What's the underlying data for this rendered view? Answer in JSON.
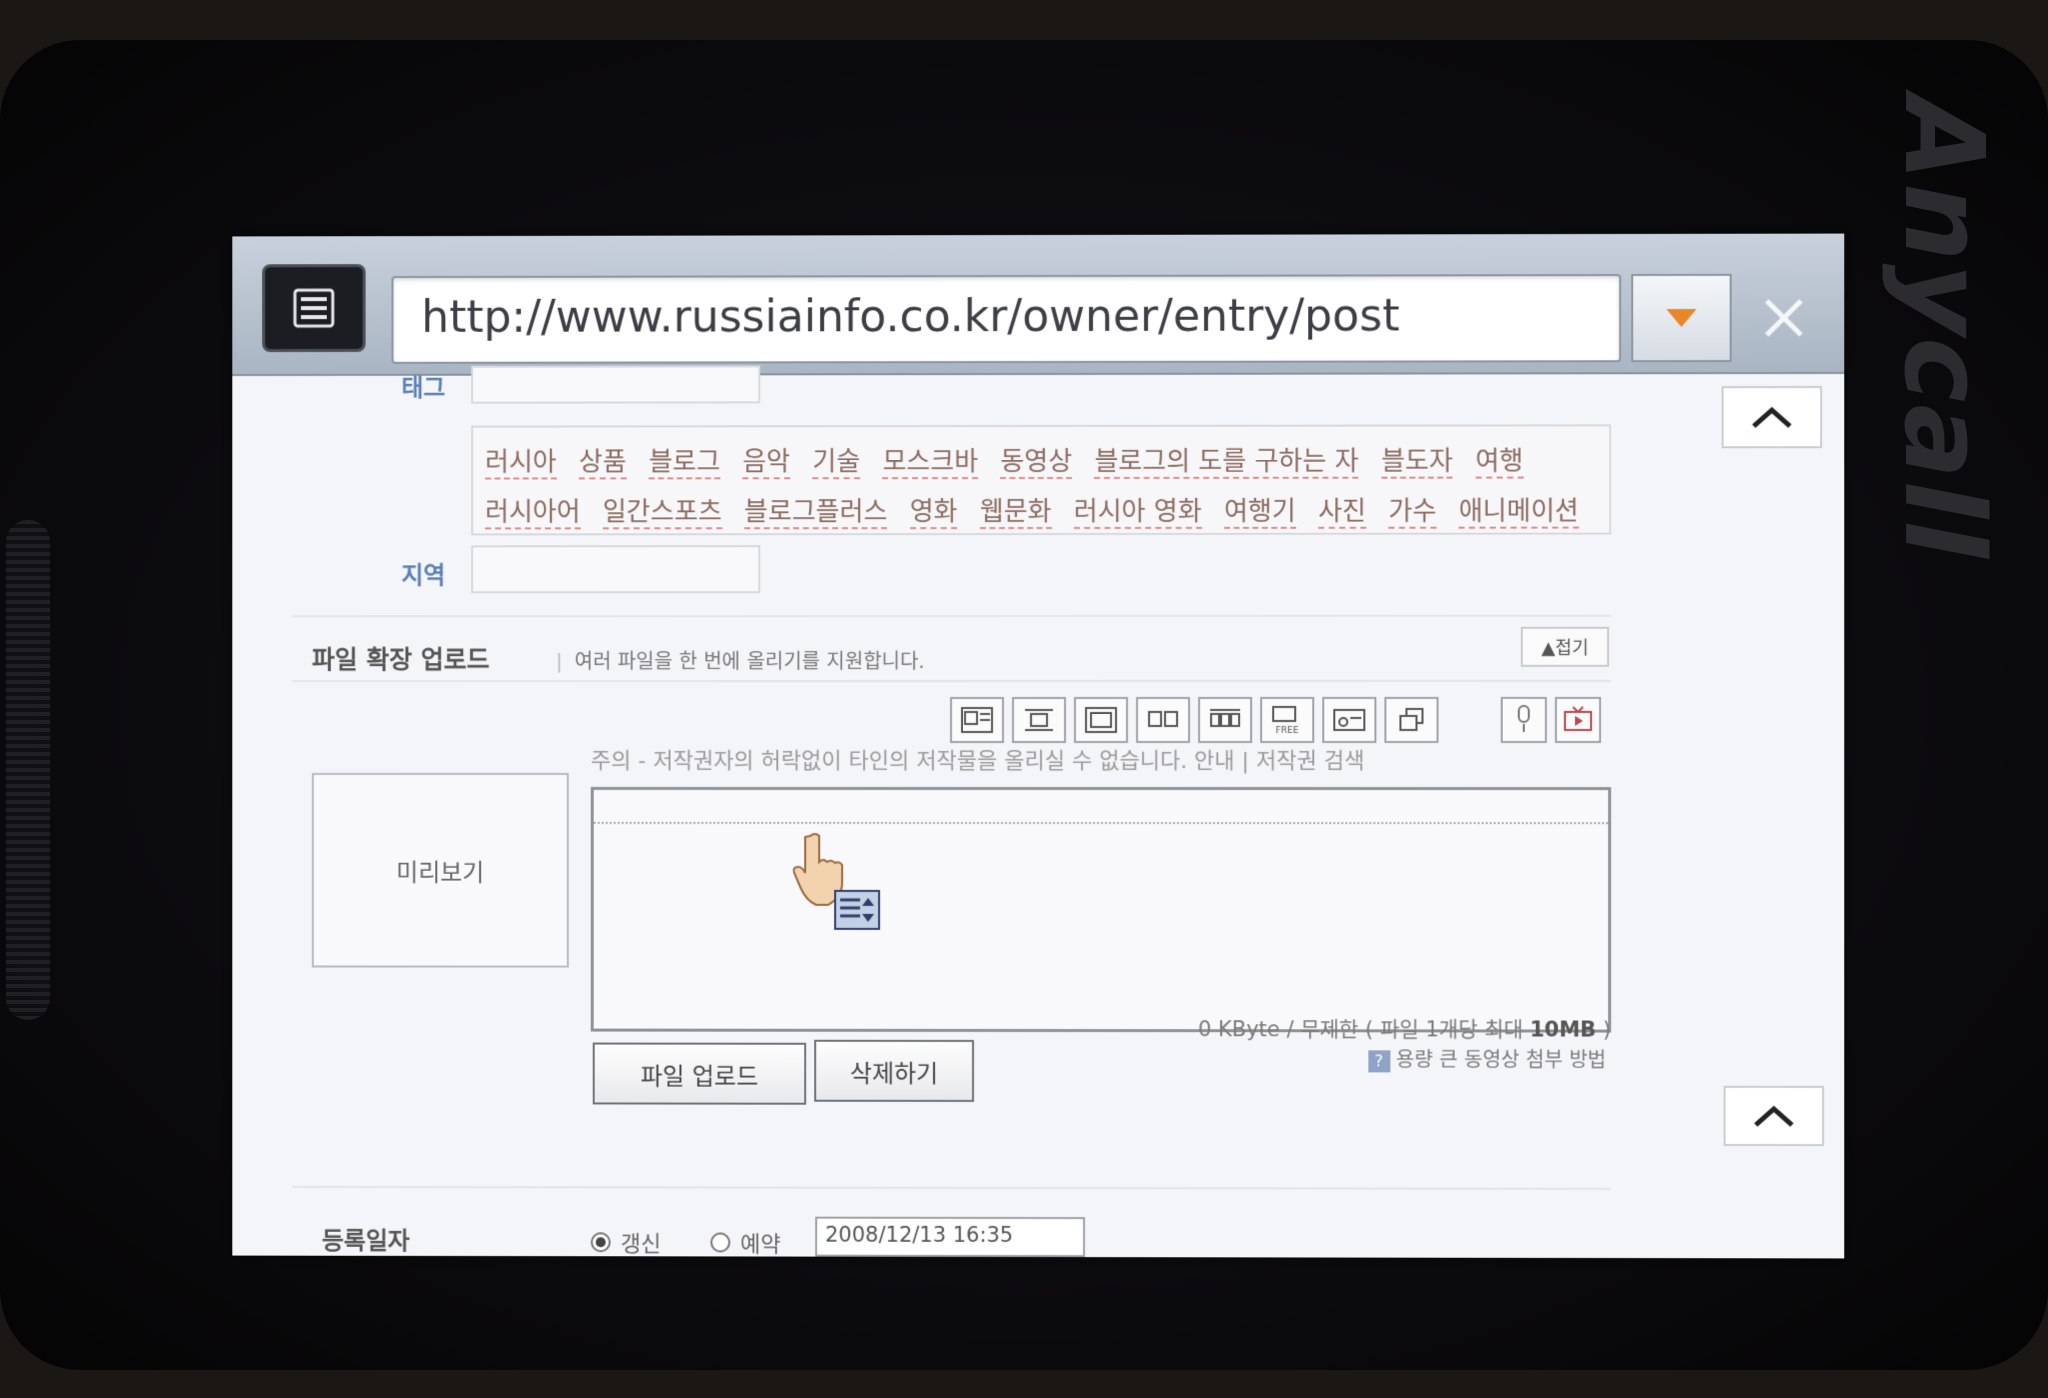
{
  "browser": {
    "url": "http://www.russiainfo.co.kr/owner/entry/post"
  },
  "device": {
    "brand": "Anycall"
  },
  "form": {
    "tag_label": "태그",
    "tags": [
      "러시아",
      "상품",
      "블로그",
      "음악",
      "기술",
      "모스크바",
      "동영상",
      "블로그의 도를 구하는 자",
      "블도자",
      "여행",
      "러시아어",
      "일간스포츠",
      "블로그플러스",
      "영화",
      "웹문화",
      "러시아 영화",
      "여행기",
      "사진",
      "가수",
      "애니메이션"
    ],
    "region_label": "지역",
    "region_value": ""
  },
  "upload": {
    "title": "파일 확장 업로드",
    "description": "여러 파일을 한 번에 올리기를 지원합니다.",
    "fold_label": "▲접기",
    "notice": "주의 - 저작권자의 허락없이 타인의 저작물을 올리실 수 없습니다. 안내 | 저작권 검색",
    "preview_label": "미리보기",
    "upload_button": "파일 업로드",
    "delete_button": "삭제하기",
    "quota_text": "0 KByte / 무제한 ( 파일 1개당 최대 ",
    "quota_max": "10MB",
    "quota_close": " )",
    "howto_icon": "?",
    "howto_text": "용량 큰 동영상 첨부 방법"
  },
  "registration": {
    "label": "등록일자",
    "option_update": "갱신",
    "option_reserve": "예약",
    "date_value": "2008/12/13 16:35"
  },
  "colors": {
    "label_blue": "#5b7fb8",
    "dropdown_arrow": "#e8872a"
  }
}
